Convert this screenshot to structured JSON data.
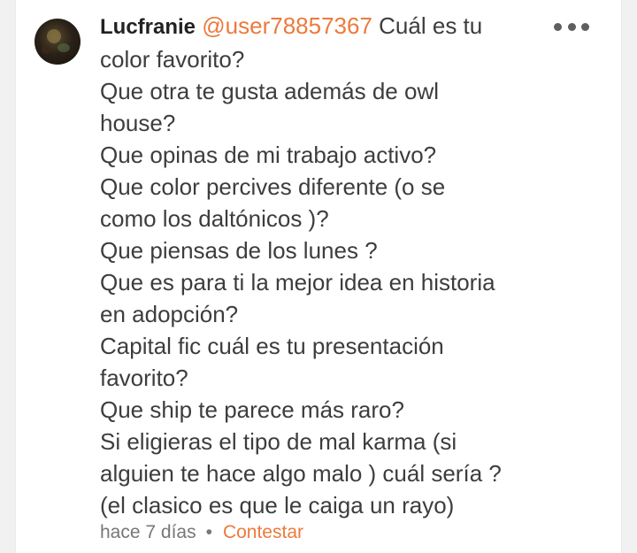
{
  "comment": {
    "author": "Lucfranie",
    "mention": "@user78857367",
    "lines": [
      "Cuál es tu",
      "color favorito?",
      "Que otra te gusta además de owl",
      "house?",
      "Que opinas de mi trabajo activo?",
      "Que color percives diferente (o se",
      "como los daltónicos )?",
      "Que piensas de los lunes ?",
      "Que es para ti la mejor idea en historia",
      "en adopción?",
      "Capital fic cuál es tu presentación",
      "favorito?",
      "Que ship te parece más raro?",
      "Si eligieras el tipo de mal karma (si",
      "alguien te hace algo malo ) cuál sería ?",
      "(el clasico es que le caiga un rayo)"
    ],
    "time": "hace 7 días",
    "separator": "•",
    "reply_label": "Contestar"
  },
  "icons": {
    "more": "more-horizontal-icon"
  },
  "colors": {
    "accent": "#ec7a3c",
    "text": "#3d3d3d",
    "author": "#222222",
    "meta": "#777777"
  }
}
